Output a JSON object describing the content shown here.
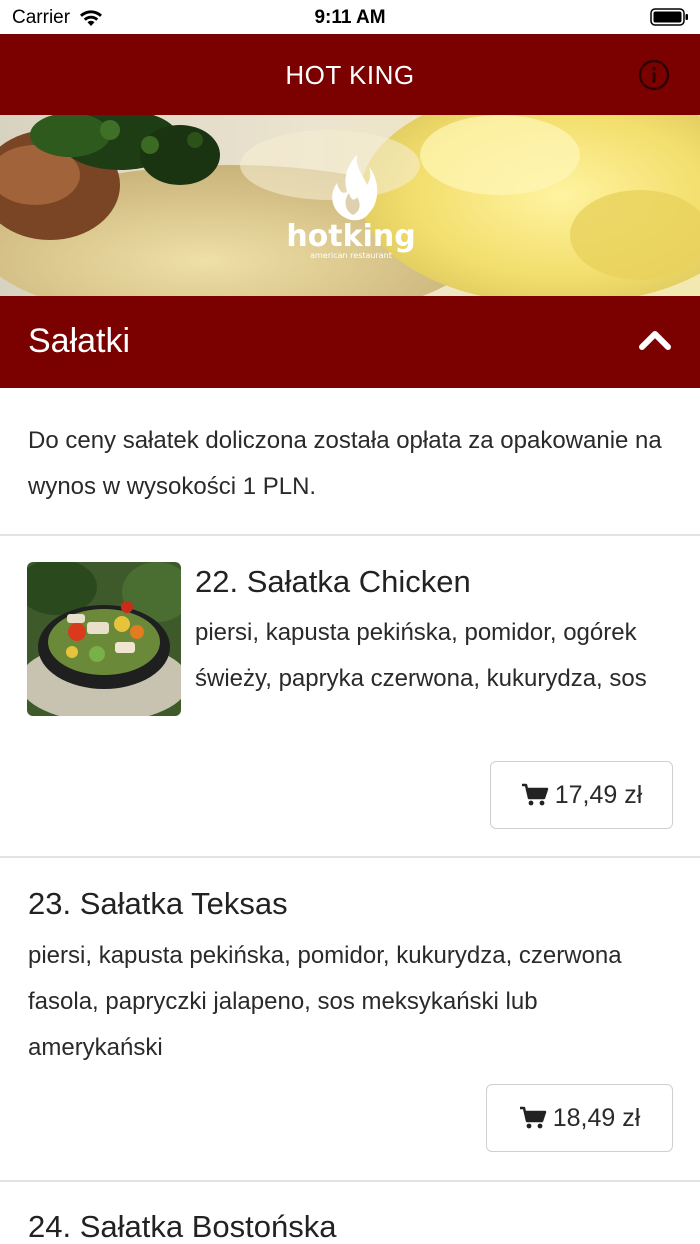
{
  "status_bar": {
    "carrier": "Carrier",
    "time": "9:11 AM"
  },
  "nav": {
    "title": "HOT KING",
    "info_icon": "info-icon"
  },
  "banner": {
    "logo_text": "hotking",
    "logo_subtext": "american restaurant"
  },
  "section": {
    "title": "Sałatki",
    "toggle_icon": "chevron-up-icon"
  },
  "note": "Do ceny sałatek doliczona została opłata za opakowanie na wynos w wysokości 1 PLN.",
  "items": [
    {
      "title": "22. Sałatka Chicken",
      "description": "piersi, kapusta pekińska, pomidor, ogórek świeży, papryka czerwona, kukurydza, sos",
      "price": "17,49 zł"
    },
    {
      "title": "23. Sałatka Teksas",
      "description": "piersi, kapusta pekińska, pomidor, kukurydza, czerwona fasola, papryczki jalapeno, sos meksykański lub amerykański",
      "price": "18,49 zł"
    },
    {
      "title": "24. Sałatka Bostońska"
    }
  ],
  "colors": {
    "brand": "#7b0000",
    "divider": "#e3e3e3"
  }
}
